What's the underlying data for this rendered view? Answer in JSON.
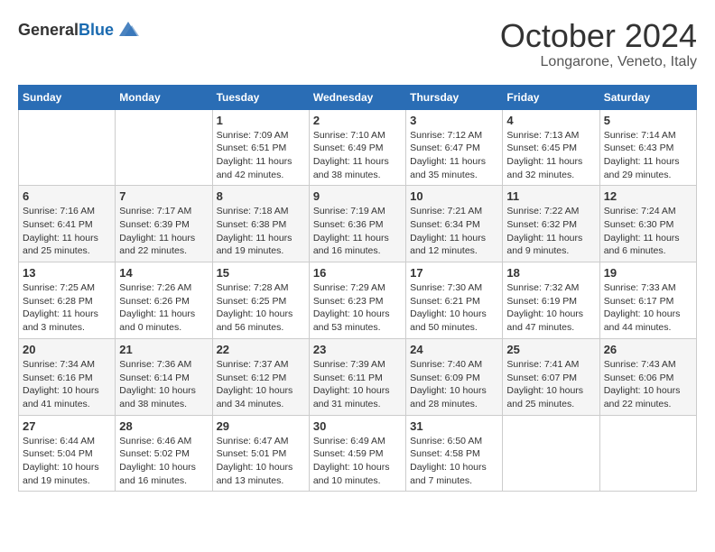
{
  "header": {
    "logo_general": "General",
    "logo_blue": "Blue",
    "month_title": "October 2024",
    "location": "Longarone, Veneto, Italy"
  },
  "weekdays": [
    "Sunday",
    "Monday",
    "Tuesday",
    "Wednesday",
    "Thursday",
    "Friday",
    "Saturday"
  ],
  "weeks": [
    [
      null,
      null,
      {
        "day": 1,
        "sunrise": "7:09 AM",
        "sunset": "6:51 PM",
        "daylight": "11 hours and 42 minutes."
      },
      {
        "day": 2,
        "sunrise": "7:10 AM",
        "sunset": "6:49 PM",
        "daylight": "11 hours and 38 minutes."
      },
      {
        "day": 3,
        "sunrise": "7:12 AM",
        "sunset": "6:47 PM",
        "daylight": "11 hours and 35 minutes."
      },
      {
        "day": 4,
        "sunrise": "7:13 AM",
        "sunset": "6:45 PM",
        "daylight": "11 hours and 32 minutes."
      },
      {
        "day": 5,
        "sunrise": "7:14 AM",
        "sunset": "6:43 PM",
        "daylight": "11 hours and 29 minutes."
      }
    ],
    [
      {
        "day": 6,
        "sunrise": "7:16 AM",
        "sunset": "6:41 PM",
        "daylight": "11 hours and 25 minutes."
      },
      {
        "day": 7,
        "sunrise": "7:17 AM",
        "sunset": "6:39 PM",
        "daylight": "11 hours and 22 minutes."
      },
      {
        "day": 8,
        "sunrise": "7:18 AM",
        "sunset": "6:38 PM",
        "daylight": "11 hours and 19 minutes."
      },
      {
        "day": 9,
        "sunrise": "7:19 AM",
        "sunset": "6:36 PM",
        "daylight": "11 hours and 16 minutes."
      },
      {
        "day": 10,
        "sunrise": "7:21 AM",
        "sunset": "6:34 PM",
        "daylight": "11 hours and 12 minutes."
      },
      {
        "day": 11,
        "sunrise": "7:22 AM",
        "sunset": "6:32 PM",
        "daylight": "11 hours and 9 minutes."
      },
      {
        "day": 12,
        "sunrise": "7:24 AM",
        "sunset": "6:30 PM",
        "daylight": "11 hours and 6 minutes."
      }
    ],
    [
      {
        "day": 13,
        "sunrise": "7:25 AM",
        "sunset": "6:28 PM",
        "daylight": "11 hours and 3 minutes."
      },
      {
        "day": 14,
        "sunrise": "7:26 AM",
        "sunset": "6:26 PM",
        "daylight": "11 hours and 0 minutes."
      },
      {
        "day": 15,
        "sunrise": "7:28 AM",
        "sunset": "6:25 PM",
        "daylight": "10 hours and 56 minutes."
      },
      {
        "day": 16,
        "sunrise": "7:29 AM",
        "sunset": "6:23 PM",
        "daylight": "10 hours and 53 minutes."
      },
      {
        "day": 17,
        "sunrise": "7:30 AM",
        "sunset": "6:21 PM",
        "daylight": "10 hours and 50 minutes."
      },
      {
        "day": 18,
        "sunrise": "7:32 AM",
        "sunset": "6:19 PM",
        "daylight": "10 hours and 47 minutes."
      },
      {
        "day": 19,
        "sunrise": "7:33 AM",
        "sunset": "6:17 PM",
        "daylight": "10 hours and 44 minutes."
      }
    ],
    [
      {
        "day": 20,
        "sunrise": "7:34 AM",
        "sunset": "6:16 PM",
        "daylight": "10 hours and 41 minutes."
      },
      {
        "day": 21,
        "sunrise": "7:36 AM",
        "sunset": "6:14 PM",
        "daylight": "10 hours and 38 minutes."
      },
      {
        "day": 22,
        "sunrise": "7:37 AM",
        "sunset": "6:12 PM",
        "daylight": "10 hours and 34 minutes."
      },
      {
        "day": 23,
        "sunrise": "7:39 AM",
        "sunset": "6:11 PM",
        "daylight": "10 hours and 31 minutes."
      },
      {
        "day": 24,
        "sunrise": "7:40 AM",
        "sunset": "6:09 PM",
        "daylight": "10 hours and 28 minutes."
      },
      {
        "day": 25,
        "sunrise": "7:41 AM",
        "sunset": "6:07 PM",
        "daylight": "10 hours and 25 minutes."
      },
      {
        "day": 26,
        "sunrise": "7:43 AM",
        "sunset": "6:06 PM",
        "daylight": "10 hours and 22 minutes."
      }
    ],
    [
      {
        "day": 27,
        "sunrise": "6:44 AM",
        "sunset": "5:04 PM",
        "daylight": "10 hours and 19 minutes."
      },
      {
        "day": 28,
        "sunrise": "6:46 AM",
        "sunset": "5:02 PM",
        "daylight": "10 hours and 16 minutes."
      },
      {
        "day": 29,
        "sunrise": "6:47 AM",
        "sunset": "5:01 PM",
        "daylight": "10 hours and 13 minutes."
      },
      {
        "day": 30,
        "sunrise": "6:49 AM",
        "sunset": "4:59 PM",
        "daylight": "10 hours and 10 minutes."
      },
      {
        "day": 31,
        "sunrise": "6:50 AM",
        "sunset": "4:58 PM",
        "daylight": "10 hours and 7 minutes."
      },
      null,
      null
    ]
  ],
  "labels": {
    "sunrise": "Sunrise:",
    "sunset": "Sunset:",
    "daylight": "Daylight:"
  }
}
